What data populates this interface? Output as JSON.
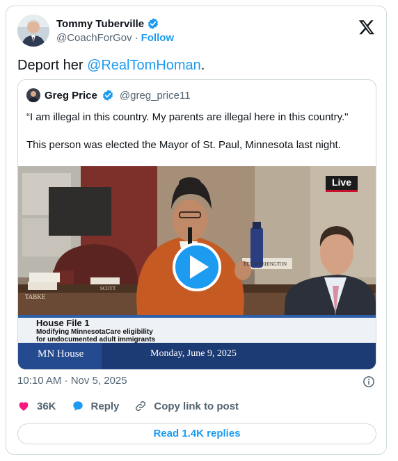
{
  "author": {
    "name": "Tommy Tuberville",
    "handle": "@CoachForGov",
    "separator": "·",
    "follow_label": "Follow"
  },
  "tweet": {
    "text_before": "Deport her ",
    "mention": "@RealTomHoman",
    "text_after": "."
  },
  "quoted": {
    "name": "Greg Price",
    "handle": "@greg_price11",
    "line1": "“I am illegal in this country. My parents are illegal here in this country.\"",
    "line2": "This person was elected the Mayor of St. Paul, Minnesota last night.",
    "video": {
      "live_badge": "Live",
      "name_tag_left": "TABKE",
      "name_tag_mid": "SCOTT",
      "name_tag_right": "REY-WASHINGTON",
      "lower_title": "House File  1",
      "lower_sub1": "Modifying MinnesotaCare eligibility",
      "lower_sub2": "for undocumented adult immigrants",
      "channel": "MN House",
      "date": "Monday, June 9, 2025"
    }
  },
  "meta": {
    "timestamp": "10:10 AM · Nov 5, 2025"
  },
  "actions": {
    "likes": "36K",
    "reply_label": "Reply",
    "copy_label": "Copy link to post"
  },
  "read_replies_label": "Read 1.4K replies",
  "colors": {
    "accent": "#1d9bf0",
    "like": "#f91880",
    "muted": "#536471",
    "border": "#cfd9de"
  }
}
